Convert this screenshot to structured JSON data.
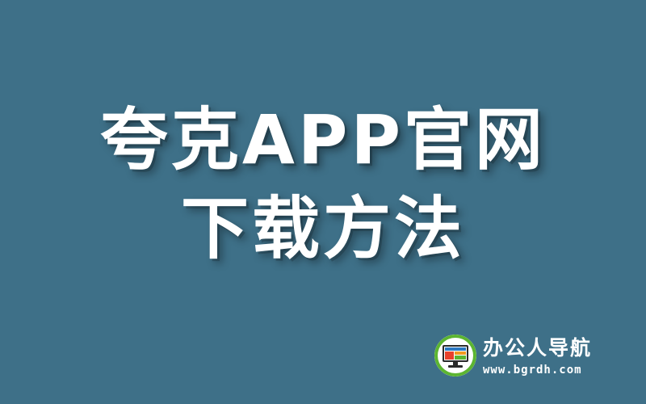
{
  "title": {
    "line1": "夸克APP官网",
    "line2": "下载方法"
  },
  "brand": {
    "logo_icon": "monitor-logo-icon",
    "name": "办公人导航",
    "url": "www.bgrdh.com"
  },
  "colors": {
    "background": "#3e7088",
    "text": "#ffffff",
    "logo_green": "#5cb531",
    "logo_blue": "#2b78c2",
    "logo_red": "#e8412c",
    "logo_orange": "#f39a1e"
  }
}
